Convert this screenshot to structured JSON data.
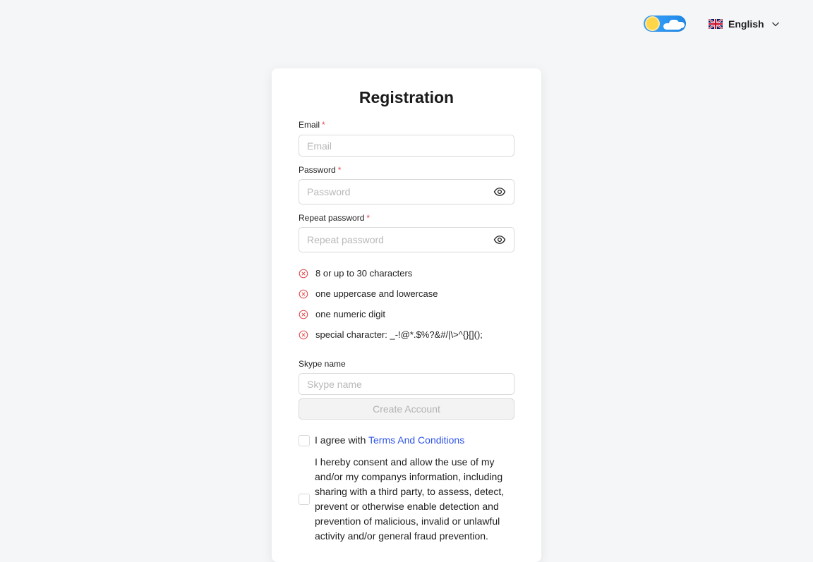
{
  "header": {
    "theme_toggle": {
      "icon": "sun-cloud-toggle-icon",
      "state": "light"
    },
    "language": {
      "label": "English",
      "flag_icon": "uk-flag-icon"
    }
  },
  "form": {
    "title": "Registration",
    "email": {
      "label": "Email",
      "required_mark": "*",
      "placeholder": "Email",
      "value": ""
    },
    "password": {
      "label": "Password",
      "required_mark": "*",
      "placeholder": "Password",
      "value": ""
    },
    "repeat_password": {
      "label": "Repeat password",
      "required_mark": "*",
      "placeholder": "Repeat password",
      "value": ""
    },
    "password_rules": [
      {
        "text": "8 or up to 30 characters",
        "status": "unmet"
      },
      {
        "text": "one uppercase and lowercase",
        "status": "unmet"
      },
      {
        "text": "one numeric digit",
        "status": "unmet"
      },
      {
        "text": "special character: _-!@*.$%?&#/|\\>^{}[]();",
        "status": "unmet"
      }
    ],
    "skype": {
      "label": "Skype name",
      "placeholder": "Skype name",
      "value": ""
    },
    "submit_label": "Create Account",
    "agree": {
      "prefix": "I agree with ",
      "link": "Terms And Conditions",
      "checked": false
    },
    "consent": {
      "text": "I hereby consent and allow the use of my and/or my companys information, including sharing with a third party, to assess, detect, prevent or otherwise enable detection and prevention of malicious, invalid or unlawful activity and/or general fraud prevention.",
      "checked": false
    }
  },
  "colors": {
    "error": "#e5484d",
    "link": "#2f54eb",
    "toggle": "#1e88e5"
  }
}
